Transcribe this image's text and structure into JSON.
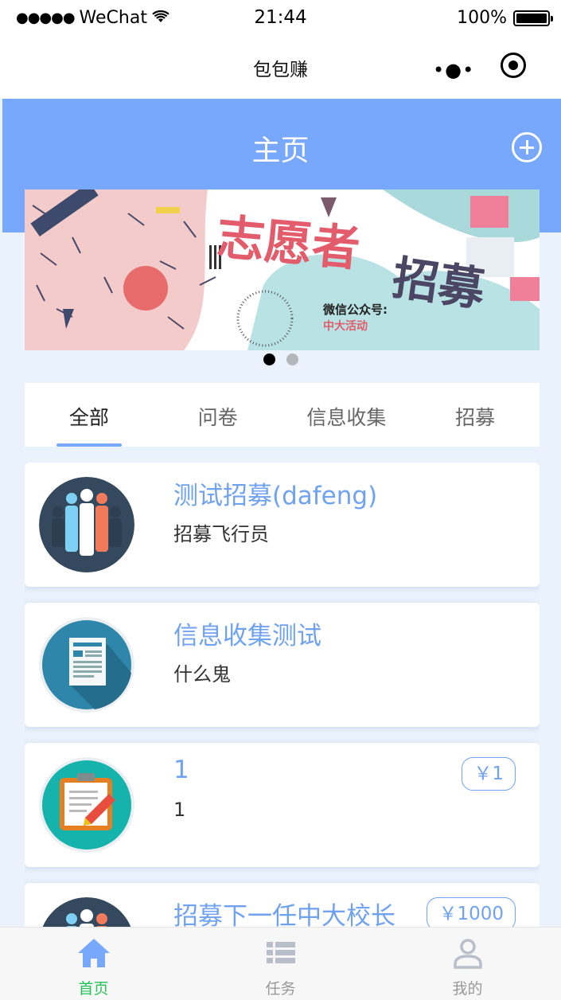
{
  "status_bar": {
    "signal": "●●●●●",
    "carrier": "WeChat",
    "time": "21:44",
    "battery": "100%"
  },
  "nav": {
    "title": "包包赚",
    "more": "•●•"
  },
  "header": {
    "title": "主页"
  },
  "banner": {
    "headline_part1": "志愿者",
    "headline_part2": "招募",
    "account_label": "微信公众号:",
    "account_name": "中大活动",
    "slide_count": 2,
    "active_slide": 0
  },
  "tabs": [
    {
      "label": "全部",
      "active": true
    },
    {
      "label": "问卷",
      "active": false
    },
    {
      "label": "信息收集",
      "active": false
    },
    {
      "label": "招募",
      "active": false
    }
  ],
  "tasks": [
    {
      "icon": "people-group-icon",
      "title": "测试招募(dafeng)",
      "desc": "招募飞行员",
      "price": ""
    },
    {
      "icon": "document-icon",
      "title": "信息收集测试",
      "desc": "什么鬼",
      "price": ""
    },
    {
      "icon": "clipboard-pencil-icon",
      "title": "1",
      "desc": "1",
      "price": "￥1"
    },
    {
      "icon": "people-group-icon",
      "title": "招募下一任中大校长",
      "desc": "",
      "price": "￥1000"
    }
  ],
  "tab_bar": [
    {
      "icon": "home-icon",
      "label": "首页",
      "active": true
    },
    {
      "icon": "list-icon",
      "label": "任务",
      "active": false
    },
    {
      "icon": "user-icon",
      "label": "我的",
      "active": false
    }
  ],
  "colors": {
    "accent": "#77a8fb",
    "title_blue": "#6fa2f0",
    "tabbar_active": "#27c159"
  }
}
